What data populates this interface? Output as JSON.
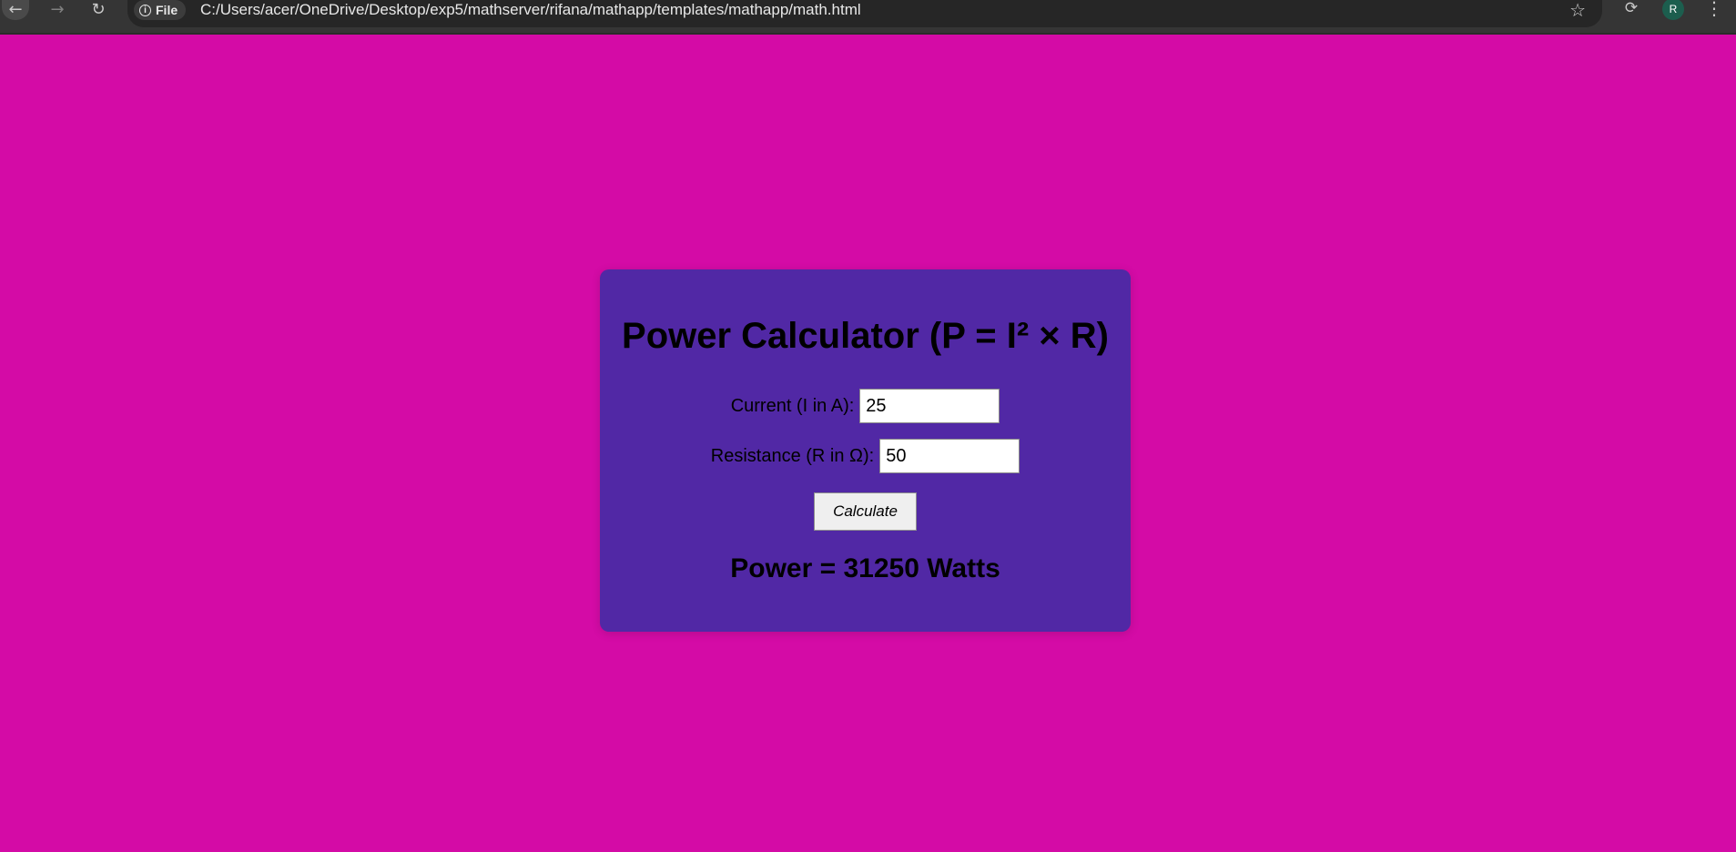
{
  "browser": {
    "file_chip_label": "File",
    "url": "C:/Users/acer/OneDrive/Desktop/exp5/mathserver/rifana/mathapp/templates/mathapp/math.html",
    "avatar_initial": "R",
    "icons": [
      "back-icon",
      "forward-icon",
      "reload-icon",
      "info-icon",
      "star-icon",
      "extension-icon",
      "menu-icon"
    ]
  },
  "page": {
    "background_color": "#d40ba6",
    "card_color": "#5128a5",
    "title": "Power Calculator (P = I² × R)",
    "fields": [
      {
        "label": "Current (I in A):",
        "value": "25"
      },
      {
        "label": "Resistance (R in Ω):",
        "value": "50"
      }
    ],
    "button_label": "Calculate",
    "result": "Power = 31250 Watts"
  }
}
